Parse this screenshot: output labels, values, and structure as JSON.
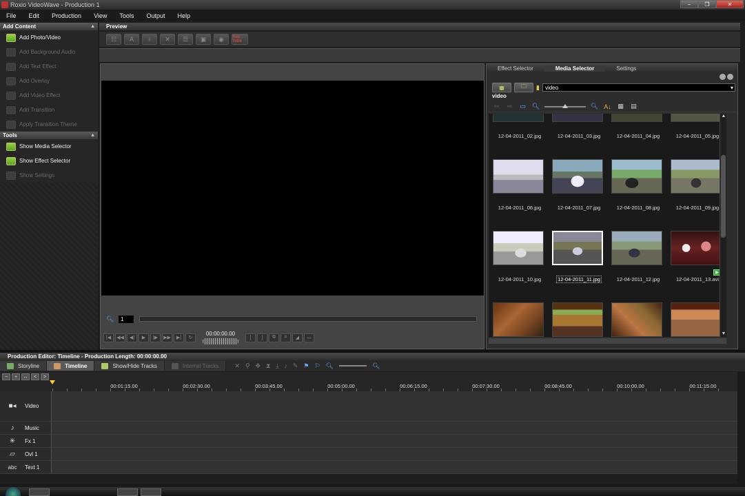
{
  "window": {
    "title": "Roxio VideoWave - Production 1",
    "controls": [
      "minimize-icon",
      "restore-icon",
      "close-icon"
    ]
  },
  "menu": [
    "File",
    "Edit",
    "Production",
    "View",
    "Tools",
    "Output",
    "Help"
  ],
  "left_panel": {
    "add_content": {
      "title": "Add Content",
      "items": [
        {
          "label": "Add Photo/Video",
          "enabled": true
        },
        {
          "label": "Add Background Audio",
          "enabled": false
        },
        {
          "label": "Add Text Effect",
          "enabled": false
        },
        {
          "label": "Add Overlay",
          "enabled": false
        },
        {
          "label": "Add Video Effect",
          "enabled": false
        },
        {
          "label": "Add Transition",
          "enabled": false
        },
        {
          "label": "Apply Transition Theme",
          "enabled": false
        }
      ]
    },
    "tools": {
      "title": "Tools",
      "items": [
        {
          "label": "Show Media Selector",
          "enabled": true
        },
        {
          "label": "Show Effect Selector",
          "enabled": true
        },
        {
          "label": "Show Settings",
          "enabled": false
        }
      ]
    }
  },
  "preview": {
    "title": "Preview",
    "toolbar_youtube": "You Tube",
    "frame_number": "1",
    "timecode": "00:00:00.00"
  },
  "selector": {
    "tabs": [
      "Effect Selector",
      "Media Selector",
      "Settings"
    ],
    "active_tab": "Media Selector",
    "path": "video",
    "folder_label": "video",
    "rows": [
      [
        "12-04-2011_02.jpg",
        "12-04-2011_03.jpg",
        "12-04-2011_04.jpg",
        "12-04-2011_05.jpg"
      ],
      [
        "12-04-2011_06.jpg",
        "12-04-2011_07.jpg",
        "12-04-2011_08.jpg",
        "12-04-2011_09.jpg"
      ],
      [
        "12-04-2011_10.jpg",
        "12-04-2011_11.jpg",
        "12-04-2011_12.jpg",
        "12-04-2011_13.avi"
      ]
    ],
    "selected": "12-04-2011_11.jpg",
    "colors": {
      "race_sky": "#c9ccc4",
      "race_road": "#556"
    }
  },
  "production_editor": {
    "title": "Production Editor: Timeline - Production Length: 00:00:00.00",
    "tabs": [
      "Storyline",
      "Timeline",
      "Show/Hide Tracks",
      "Internal Tracks"
    ],
    "active_tab": "Timeline",
    "ruler": [
      "00:01:15.00",
      "00:02:30.00",
      "00:03:45.00",
      "00:05:00.00",
      "00:06:15.00",
      "00:07:30.00",
      "00:08:45.00",
      "00:10:00.00",
      "00:11:15.00"
    ],
    "tracks": [
      {
        "label": "Video",
        "icon": "camera-icon"
      },
      {
        "label": "Music",
        "icon": "music-note-icon"
      },
      {
        "label": "Fx 1",
        "icon": "sparkle-icon"
      },
      {
        "label": "Ovl 1",
        "icon": "overlay-icon"
      },
      {
        "label": "Text 1",
        "icon": "abc"
      }
    ]
  }
}
